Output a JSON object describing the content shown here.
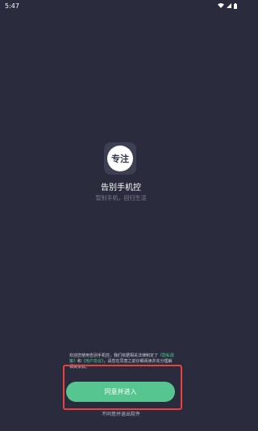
{
  "status_bar": {
    "time": "5:47",
    "wifi_icon": "wifi-icon",
    "signal_icon": "signal-icon",
    "battery_icon": "battery-icon"
  },
  "app": {
    "icon_text": "专注",
    "name": "告别手机控",
    "slogan": "暂别手机，回归生活"
  },
  "privacy": {
    "text_before": "欢迎您使用告别手机控，我们依据相关法律制定了",
    "privacy_link": "《隐私政策》",
    "and": "和",
    "user_link": "《用户协议》",
    "text_after": "，请您在同意之前仔细阅读并充分理解相关条款。"
  },
  "buttons": {
    "agree": "同意并进入",
    "disagree": "不同意并退出软件"
  },
  "colors": {
    "background": "#2a2b3d",
    "accent_green": "#57c58f",
    "highlight_red": "#e8413e"
  }
}
